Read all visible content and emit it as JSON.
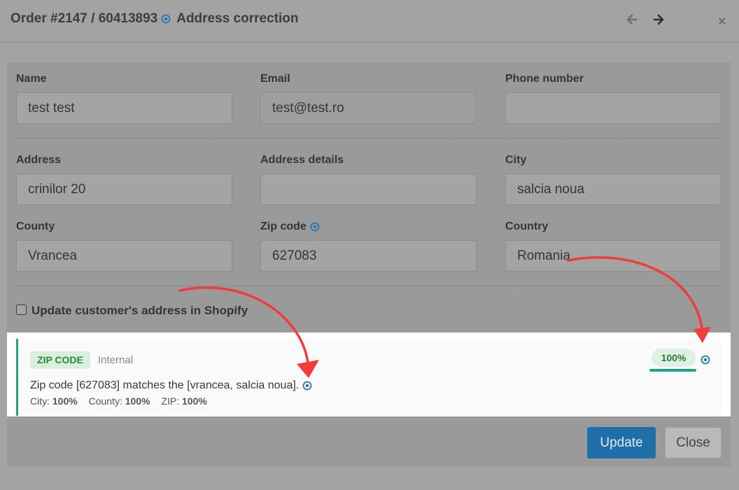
{
  "header": {
    "title": "Order #2147 / 60413893",
    "subtitle": "Address correction"
  },
  "form": {
    "name": {
      "label": "Name",
      "value": "test test"
    },
    "email": {
      "label": "Email",
      "value": "test@test.ro"
    },
    "phone": {
      "label": "Phone number",
      "value": ""
    },
    "address": {
      "label": "Address",
      "value": "crinilor 20"
    },
    "address_details": {
      "label": "Address details",
      "value": ""
    },
    "city": {
      "label": "City",
      "value": "salcia noua"
    },
    "county": {
      "label": "County",
      "value": "Vrancea"
    },
    "zip": {
      "label": "Zip code",
      "value": "627083"
    },
    "country": {
      "label": "Country",
      "value": "Romania"
    },
    "update_shopify_label": "Update customer's address in Shopify",
    "update_shopify_checked": false
  },
  "result": {
    "badge": "ZIP CODE",
    "source": "Internal",
    "message": "Zip code [627083] matches the [vrancea, salcia noua].",
    "scores": {
      "city_label": "City:",
      "city_value": "100%",
      "county_label": "County:",
      "county_value": "100%",
      "zip_label": "ZIP:",
      "zip_value": "100%"
    },
    "confidence": "100%",
    "confidence_fraction": 1.0
  },
  "buttons": {
    "update": "Update",
    "close": "Close"
  },
  "icons": {
    "info": "info-circle-icon",
    "prev": "arrow-left-icon",
    "next": "arrow-right-icon",
    "close": "close-icon"
  },
  "colors": {
    "accent_blue": "#1f6fa8",
    "success_green": "#21a38b",
    "badge_green_bg": "#d8efdd",
    "annotation_red": "#f03c3c"
  }
}
